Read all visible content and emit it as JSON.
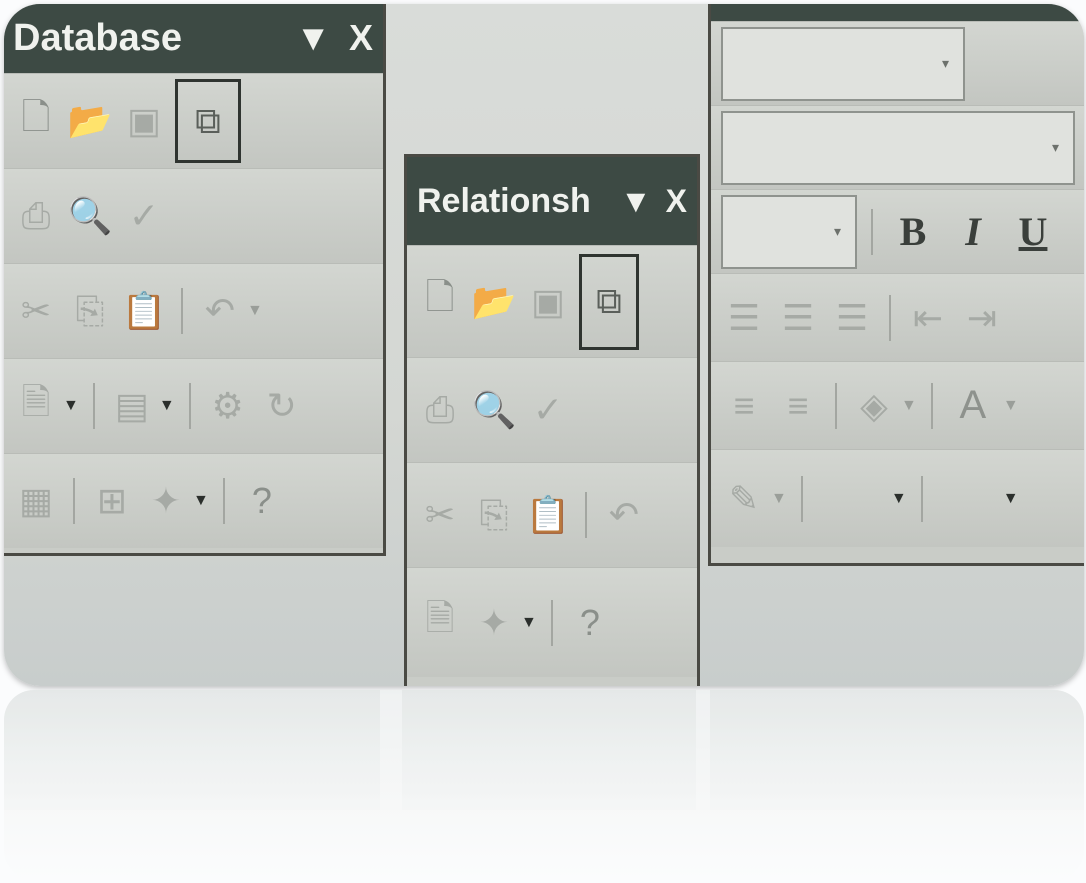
{
  "toolbars": {
    "database": {
      "title": "Database",
      "menu_arrow": "▼",
      "close": "X"
    },
    "relationship": {
      "title": "Relationsh",
      "menu_arrow": "▼",
      "close": "X"
    },
    "formatting": {
      "bold": "B",
      "italic": "I",
      "underline": "U",
      "font_color": "A"
    }
  },
  "glyphs": {
    "dropdown": "▼",
    "combo_arrow": "▾"
  },
  "icons": [
    "new-icon",
    "open-icon",
    "save-icon",
    "relationships-icon",
    "print-icon",
    "print-preview-icon",
    "spelling-icon",
    "cut-icon",
    "copy-icon",
    "paste-icon",
    "undo-icon",
    "office-links-icon",
    "analyze-icon",
    "code-icon",
    "script-icon",
    "properties-icon",
    "relationships-icon-2",
    "new-object-icon",
    "help-icon",
    "align-left-icon",
    "center-icon",
    "align-right-icon",
    "decrease-indent-icon",
    "increase-indent-icon",
    "numbering-icon",
    "bullets-icon",
    "fill-color-icon",
    "line-color-icon"
  ]
}
